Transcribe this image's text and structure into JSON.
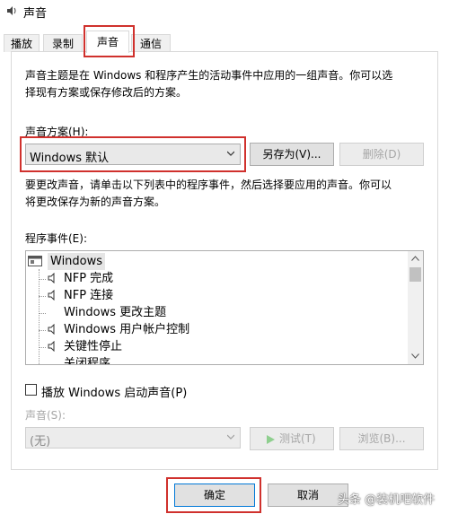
{
  "window": {
    "title": "声音"
  },
  "tabs": [
    {
      "label": "播放"
    },
    {
      "label": "录制"
    },
    {
      "label": "声音"
    },
    {
      "label": "通信"
    }
  ],
  "intro_text_1": "声音主题是在 Windows 和程序产生的活动事件中应用的一组声音。你可以选",
  "intro_text_2": "择现有方案或保存修改后的方案。",
  "scheme": {
    "label": "声音方案(H):",
    "selected": "Windows 默认",
    "save_as_label": "另存为(V)...",
    "delete_label": "删除(D)"
  },
  "change_text_1": "要更改声音，请单击以下列表中的程序事件，然后选择要应用的声音。你可以",
  "change_text_2": "将更改保存为新的声音方案。",
  "events": {
    "label": "程序事件(E):",
    "root": "Windows",
    "items": [
      {
        "label": "NFP 完成",
        "has_sound": true
      },
      {
        "label": "NFP 连接",
        "has_sound": true
      },
      {
        "label": "Windows 更改主题",
        "has_sound": false
      },
      {
        "label": "Windows 用户帐户控制",
        "has_sound": true
      },
      {
        "label": "关键性停止",
        "has_sound": true
      },
      {
        "label": "关闭程序",
        "has_sound": false
      }
    ]
  },
  "startup": {
    "label": "播放 Windows 启动声音(P)",
    "checked": false
  },
  "sound": {
    "label": "声音(S):",
    "selected": "(无)",
    "test_label": "测试(T)",
    "browse_label": "浏览(B)..."
  },
  "footer": {
    "ok_label": "确定",
    "cancel_label": "取消",
    "watermark": "头条 @装机吧软件"
  },
  "colors": {
    "highlight_box": "#d0312d",
    "focus_blue": "#0078d7",
    "disabled_text": "#a6a6a6"
  }
}
